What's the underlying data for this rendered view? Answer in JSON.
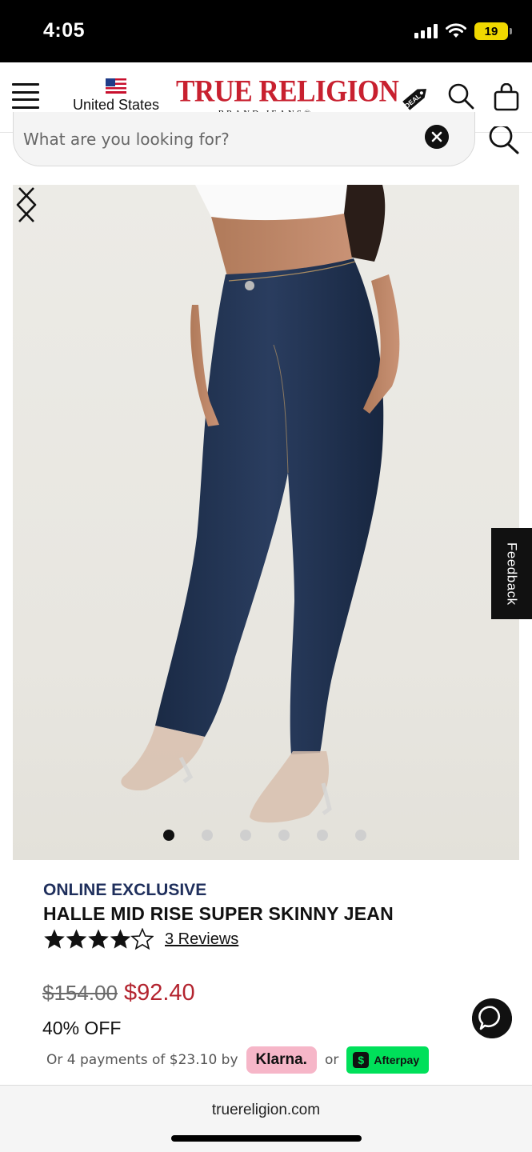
{
  "status_bar": {
    "time": "4:05",
    "battery": "19"
  },
  "header": {
    "region_label": "United States",
    "brand_name": "TRUE RELIGION",
    "brand_sub": "BRAND JEANS®",
    "deals_badge": "DEAL"
  },
  "search": {
    "placeholder": "What are you looking for?"
  },
  "gallery": {
    "image_count": 6,
    "active_index": 0
  },
  "feedback": {
    "label": "Feedback"
  },
  "product": {
    "tag": "ONLINE EXCLUSIVE",
    "title": "HALLE MID RISE SUPER SKINNY JEAN",
    "rating": 4.5,
    "reviews_label": "3 Reviews",
    "original_price": "$154.00",
    "sale_price": "$92.40",
    "discount": "40% OFF"
  },
  "payment": {
    "text": "Or 4 payments of $23.10 by",
    "klarna_label": "Klarna.",
    "or_label": "or",
    "afterpay_label": "Afterpay"
  },
  "browser": {
    "url": "truereligion.com"
  },
  "colors": {
    "brand_red": "#c8202f",
    "sale_red": "#b3242f",
    "exclusive_navy": "#1f2f5c",
    "klarna_pink": "#f6b6c8",
    "afterpay_green": "#00e05a"
  }
}
